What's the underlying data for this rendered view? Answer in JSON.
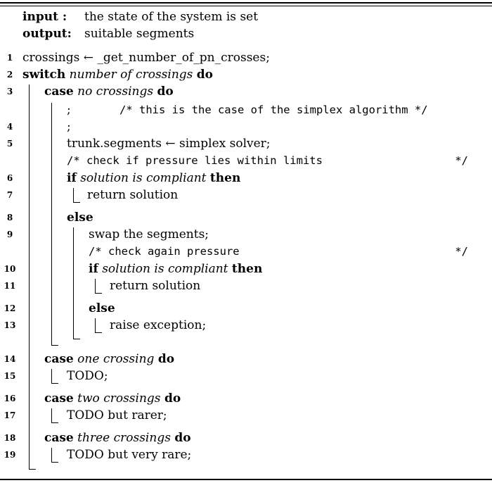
{
  "header": {
    "input_label": "input :",
    "input_text": "the state of the system is set",
    "output_label": "output:",
    "output_text": "suitable segments"
  },
  "lines": {
    "l1": {
      "num": "1",
      "text": "crossings ← _get_number_of_pn_crosses;"
    },
    "l2": {
      "num": "2",
      "kw1": "switch",
      "it": "number of crossings",
      "kw2": "do"
    },
    "l3": {
      "num": "3",
      "kw1": "case",
      "it": "no crossings",
      "kw2": "do"
    },
    "l3b": {
      "semi": ";",
      "comment": "/* this is the case of the simplex algorithm */"
    },
    "l4": {
      "num": "4",
      "text": ";"
    },
    "l5": {
      "num": "5",
      "text": "trunk.segments ← simplex solver;"
    },
    "l5c": {
      "comment": "/* check if pressure lies within limits",
      "end": "*/"
    },
    "l6": {
      "num": "6",
      "kw1": "if",
      "it": "solution is compliant",
      "kw2": "then"
    },
    "l7": {
      "num": "7",
      "text": "return solution"
    },
    "l8": {
      "num": "8",
      "kw": "else"
    },
    "l9": {
      "num": "9",
      "text": "swap the segments;"
    },
    "l9c": {
      "comment": "/* check again pressure",
      "end": "*/"
    },
    "l10": {
      "num": "10",
      "kw1": "if",
      "it": "solution is compliant",
      "kw2": "then"
    },
    "l11": {
      "num": "11",
      "text": "return solution"
    },
    "l12": {
      "num": "12",
      "kw": "else"
    },
    "l13": {
      "num": "13",
      "text": "raise exception;"
    },
    "l14": {
      "num": "14",
      "kw1": "case",
      "it": "one crossing",
      "kw2": "do"
    },
    "l15": {
      "num": "15",
      "text": "TODO;"
    },
    "l16": {
      "num": "16",
      "kw1": "case",
      "it": "two crossings",
      "kw2": "do"
    },
    "l17": {
      "num": "17",
      "text": "TODO but rarer;"
    },
    "l18": {
      "num": "18",
      "kw1": "case",
      "it": "three crossings",
      "kw2": "do"
    },
    "l19": {
      "num": "19",
      "text": "TODO but very rare;"
    }
  }
}
